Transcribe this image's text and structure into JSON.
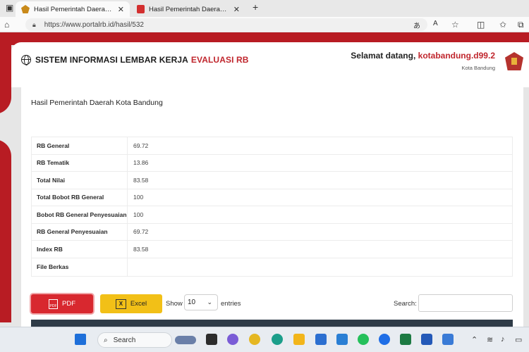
{
  "browser": {
    "tabs": [
      {
        "title": "Hasil Pemerintah Daerah Kota Ba",
        "active": true,
        "icon": "garuda-favicon"
      },
      {
        "title": "Hasil Pemerintah Daerah Kota Ba",
        "active": false,
        "icon": "pdf-favicon"
      }
    ],
    "new_tab_glyph": "+",
    "close_glyph": "✕",
    "url": "https://www.portalrb.id/hasil/532"
  },
  "header": {
    "system_name": "SISTEM INFORMASI LEMBAR KERJA",
    "system_name_highlight": "EVALUASI RB",
    "welcome_prefix": "Selamat datang,",
    "username": "kotabandung.d99.2",
    "region": "Kota Bandung"
  },
  "card": {
    "title": "Hasil Pemerintah Daerah Kota Bandung",
    "rows": [
      {
        "label": "RB General",
        "value": "69.72"
      },
      {
        "label": "RB Tematik",
        "value": "13.86"
      },
      {
        "label": "Total Nilai",
        "value": "83.58"
      },
      {
        "label": "Total Bobot RB General",
        "value": "100"
      },
      {
        "label": "Bobot RB General Penyesuaian",
        "value": "100"
      },
      {
        "label": "RB General Penyesuaian",
        "value": "69.72"
      },
      {
        "label": "Index RB",
        "value": "83.58"
      },
      {
        "label": "File Berkas",
        "value": ""
      }
    ],
    "pdf_button": "PDF",
    "excel_button": "Excel",
    "show_label": "Show",
    "entries_value": "10",
    "entries_label": "entries",
    "search_label": "Search:",
    "search_value": ""
  },
  "taskbar": {
    "search_label": "Search"
  },
  "colors": {
    "brand_red": "#b81c23",
    "accent_red": "#c0262d",
    "pdf_button": "#d8282f",
    "excel_button": "#f2c017"
  }
}
